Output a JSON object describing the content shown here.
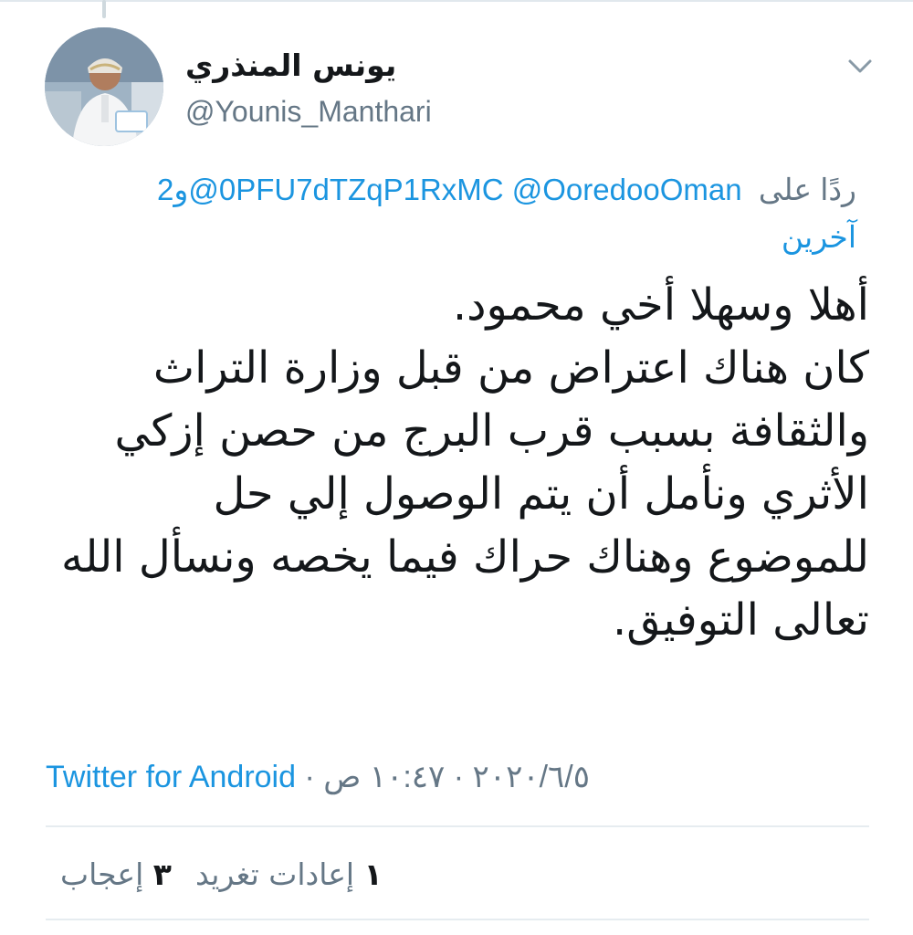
{
  "tweet": {
    "author": {
      "display_name": "يونس المنذري",
      "handle": "@Younis_Manthari"
    },
    "reply_to": {
      "prefix": "ردًا على",
      "mentions": [
        "@0PFU7dTZqP1RxMC",
        "@OoredooOman"
      ],
      "suffix": "و2",
      "others": "آخرين"
    },
    "body_lines": [
      "أهلا وسهلا أخي محمود.",
      "كان هناك اعتراض من قبل وزارة التراث",
      "والثقافة بسبب قرب البرج من حصن إزكي",
      "الأثري ونأمل أن يتم الوصول إلي حل",
      "للموضوع وهناك حراك فيما يخصه ونسأل الله",
      "تعالى التوفيق."
    ],
    "meta": {
      "time": "١٠:٤٧ ص",
      "date": "٢٠٢٠/٦/٥",
      "separator": "·",
      "source": "Twitter for Android"
    },
    "stats": {
      "retweets_count": "١",
      "retweets_label": "إعادات تغريد",
      "likes_count": "٣",
      "likes_label": "إعجاب"
    }
  },
  "icons": {
    "caret": "chevron-down-icon"
  },
  "colors": {
    "link": "#1b95e0",
    "secondary_text": "#657786",
    "primary_text": "#14171a",
    "divider": "#e6ecf0"
  }
}
